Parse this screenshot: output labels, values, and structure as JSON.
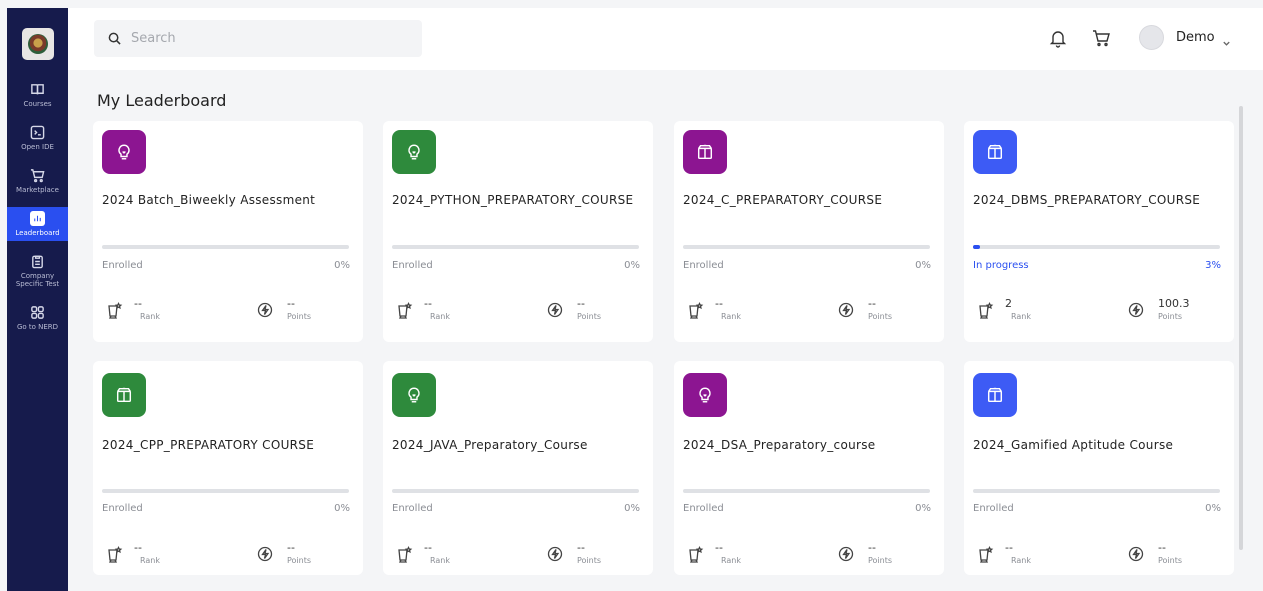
{
  "sidebar": {
    "items": [
      {
        "label": "Courses",
        "icon": "book-icon"
      },
      {
        "label": "Open IDE",
        "icon": "terminal-icon"
      },
      {
        "label": "Marketplace",
        "icon": "cart-icon"
      },
      {
        "label": "Leaderboard",
        "icon": "chart-icon"
      },
      {
        "label": "Company Specific Test",
        "icon": "clipboard-icon"
      },
      {
        "label": "Go to NERD",
        "icon": "grid-icon"
      }
    ],
    "active_index": 3
  },
  "header": {
    "search_placeholder": "Search",
    "user_name": "Demo"
  },
  "page": {
    "title": "My Leaderboard"
  },
  "labels": {
    "rank": "Rank",
    "points": "Points"
  },
  "colors": {
    "sidebar": "#161b4c",
    "accent": "#2a4ff0",
    "badge_purple": "#8c1591",
    "badge_green": "#2e8a3c",
    "badge_blue": "#3d5bf5"
  },
  "cards": [
    {
      "name": "2024 Batch_Biweekly Assessment",
      "badge_color": "#8c1591",
      "badge_icon": "bulb-icon",
      "status": "Enrolled",
      "progress": "0%",
      "rank": "--",
      "points": "--"
    },
    {
      "name": "2024_PYTHON_PREPARATORY_COURSE",
      "badge_color": "#2e8a3c",
      "badge_icon": "bulb-icon",
      "status": "Enrolled",
      "progress": "0%",
      "rank": "--",
      "points": "--"
    },
    {
      "name": "2024_C_PREPARATORY_COURSE",
      "badge_color": "#8c1591",
      "badge_icon": "book-open-icon",
      "status": "Enrolled",
      "progress": "0%",
      "rank": "--",
      "points": "--"
    },
    {
      "name": "2024_DBMS_PREPARATORY_COURSE",
      "badge_color": "#3d5bf5",
      "badge_icon": "book-open-icon",
      "status": "In progress",
      "progress": "3%",
      "rank": "2",
      "points": "100.3"
    },
    {
      "name": "2024_CPP_PREPARATORY COURSE",
      "badge_color": "#2e8a3c",
      "badge_icon": "book-open-icon",
      "status": "Enrolled",
      "progress": "0%",
      "rank": "--",
      "points": "--"
    },
    {
      "name": "2024_JAVA_Preparatory_Course",
      "badge_color": "#2e8a3c",
      "badge_icon": "bulb-icon",
      "status": "Enrolled",
      "progress": "0%",
      "rank": "--",
      "points": "--"
    },
    {
      "name": "2024_DSA_Preparatory_course",
      "badge_color": "#8c1591",
      "badge_icon": "bulb-icon",
      "status": "Enrolled",
      "progress": "0%",
      "rank": "--",
      "points": "--"
    },
    {
      "name": "2024_Gamified Aptitude Course",
      "badge_color": "#3d5bf5",
      "badge_icon": "book-open-icon",
      "status": "Enrolled",
      "progress": "0%",
      "rank": "--",
      "points": "--"
    }
  ]
}
